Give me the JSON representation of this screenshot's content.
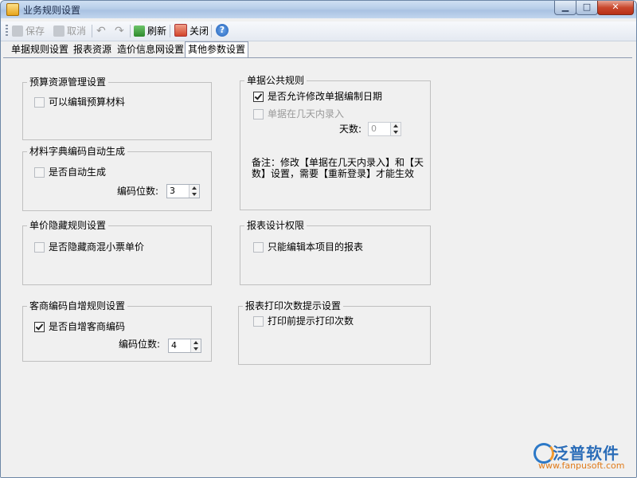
{
  "window": {
    "title": "业务规则设置"
  },
  "titlebar_buttons": {
    "minimize": "▁",
    "maximize": "□",
    "close": "✕"
  },
  "toolbar": {
    "save": "保存",
    "cancel": "取消",
    "undo": "↶",
    "redo": "↷",
    "refresh": "刷新",
    "close": "关闭",
    "help": "?"
  },
  "tabs": [
    "单据规则设置",
    "报表资源",
    "造价信息网设置",
    "其他参数设置"
  ],
  "active_tab": "其他参数设置",
  "groups": {
    "budget": {
      "title": "预算资源管理设置",
      "checkbox_label": "可以编辑预算材料",
      "checked": false
    },
    "material_code": {
      "title": "材料字典编码自动生成",
      "checkbox_label": "是否自动生成",
      "checked": false,
      "digits_label": "编码位数:",
      "digits_value": "3"
    },
    "price_hide": {
      "title": "单价隐藏规则设置",
      "checkbox_label": "是否隐藏商混小票单价",
      "checked": false
    },
    "customer_code": {
      "title": "客商编码自增规则设置",
      "checkbox_label": "是否自增客商编码",
      "checked": true,
      "digits_label": "编码位数:",
      "digits_value": "4"
    },
    "doc_rules": {
      "title": "单据公共规则",
      "checkbox1_label": "是否允许修改单据编制日期",
      "checkbox1_checked": true,
      "checkbox2_label": "单据在几天内录入",
      "checkbox2_checked": false,
      "days_label": "天数:",
      "days_value": "0",
      "note": "备注：修改【单据在几天内录入】和【天数】设置，需要【重新登录】才能生效"
    },
    "report_design": {
      "title": "报表设计权限",
      "checkbox_label": "只能编辑本项目的报表",
      "checked": false
    },
    "print_count": {
      "title": "报表打印次数提示设置",
      "checkbox_label": "打印前提示打印次数",
      "checked": false
    }
  },
  "logo": {
    "name": "泛普软件",
    "url": "www.fanpusoft.com"
  },
  "colors": {
    "title_gradient": "#b7cde8",
    "close_button": "#c9482d",
    "logo_blue": "#2b6db8",
    "logo_orange": "#e07b1a"
  }
}
